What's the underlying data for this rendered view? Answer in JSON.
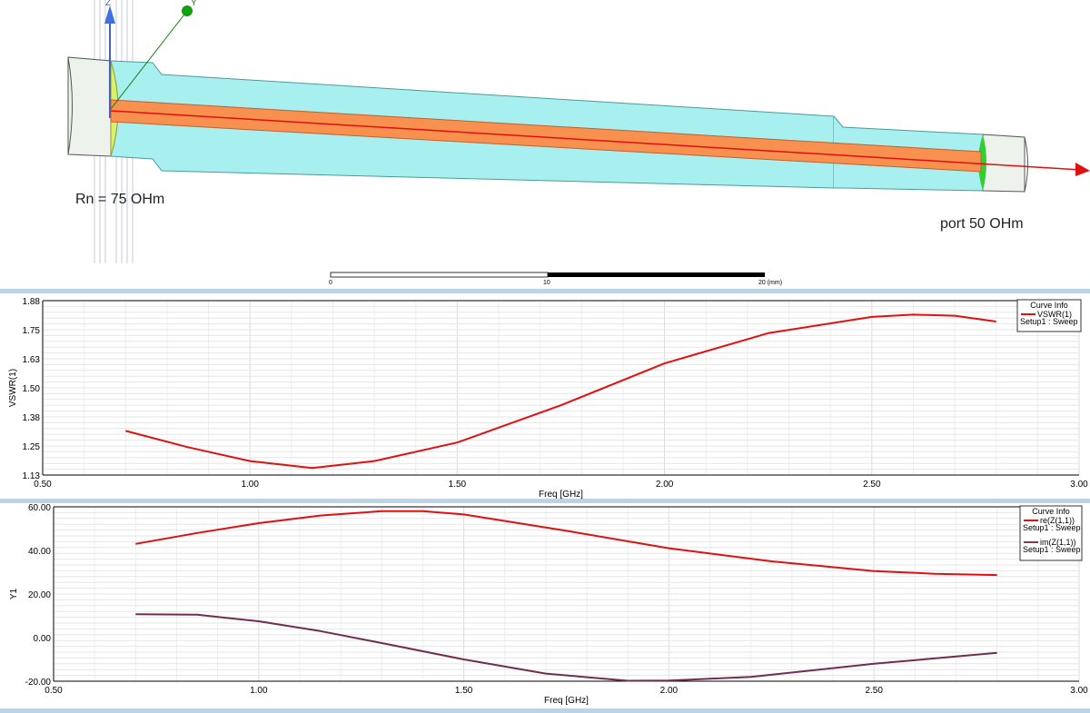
{
  "view3d": {
    "left_label": "Rn = 75 OHm",
    "right_label": "port 50 OHm",
    "axis_labels": [
      "Z",
      "Y"
    ],
    "scale_bar": {
      "ticks": [
        "0",
        "10",
        "20 (mm)"
      ]
    }
  },
  "chart_data": [
    {
      "type": "line",
      "title": "",
      "xlabel": "Freq [GHz]",
      "ylabel": "VSWR(1)",
      "xlim": [
        0.5,
        3.0
      ],
      "ylim": [
        1.13,
        1.88
      ],
      "xticks": [
        "0.50",
        "1.00",
        "1.50",
        "2.00",
        "2.50",
        "3.00"
      ],
      "yticks": [
        "1.13",
        "1.25",
        "1.38",
        "1.50",
        "1.63",
        "1.75",
        "1.88"
      ],
      "legend": {
        "title": "Curve Info",
        "placement": "top-right",
        "entries": [
          {
            "name": "VSWR(1)",
            "sub": "Setup1 : Sweep",
            "color": "#e01010"
          }
        ]
      },
      "series": [
        {
          "name": "VSWR(1)",
          "color": "#e01010",
          "x": [
            0.7,
            0.85,
            1.0,
            1.15,
            1.3,
            1.5,
            1.75,
            2.0,
            2.25,
            2.5,
            2.6,
            2.7,
            2.8
          ],
          "y": [
            1.32,
            1.25,
            1.19,
            1.16,
            1.19,
            1.27,
            1.43,
            1.61,
            1.74,
            1.81,
            1.82,
            1.815,
            1.79
          ]
        }
      ]
    },
    {
      "type": "line",
      "title": "",
      "xlabel": "Freq [GHz]",
      "ylabel": "Y1",
      "xlim": [
        0.5,
        3.0
      ],
      "ylim": [
        -20,
        60
      ],
      "xticks": [
        "0.50",
        "1.00",
        "1.50",
        "2.00",
        "2.50",
        "3.00"
      ],
      "yticks": [
        "-20.00",
        "0.00",
        "20.00",
        "40.00",
        "60.00"
      ],
      "legend": {
        "title": "Curve Info",
        "placement": "top-right",
        "entries": [
          {
            "name": "re(Z(1,1))",
            "sub": "Setup1 : Sweep",
            "color": "#e01010"
          },
          {
            "name": "im(Z(1,1))",
            "sub": "Setup1 : Sweep",
            "color": "#7a3a5a"
          }
        ]
      },
      "series": [
        {
          "name": "re(Z(1,1))",
          "color": "#e01010",
          "x": [
            0.7,
            0.85,
            1.0,
            1.15,
            1.3,
            1.4,
            1.5,
            1.75,
            2.0,
            2.25,
            2.5,
            2.65,
            2.8
          ],
          "y": [
            43,
            48,
            52.5,
            56,
            58,
            58,
            56.5,
            49,
            41,
            35,
            30.5,
            29.3,
            28.7
          ]
        },
        {
          "name": "im(Z(1,1))",
          "color": "#6e2e50",
          "x": [
            0.7,
            0.85,
            1.0,
            1.15,
            1.3,
            1.5,
            1.7,
            1.9,
            2.0,
            2.2,
            2.5,
            2.8
          ],
          "y": [
            10.7,
            10.5,
            7.5,
            3,
            -2.5,
            -10,
            -16.5,
            -19.8,
            -19.7,
            -18,
            -12,
            -7
          ]
        }
      ]
    }
  ]
}
